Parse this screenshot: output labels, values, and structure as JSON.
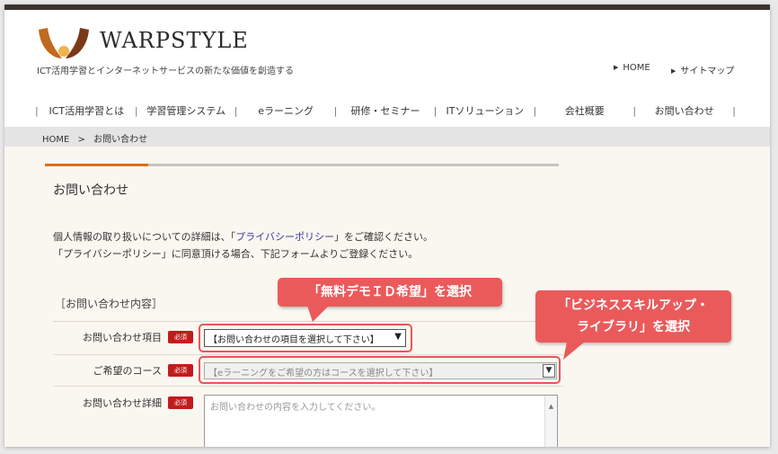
{
  "header": {
    "logo_text": "WARPSTYLE",
    "tagline": "ICT活用学習とインターネットサービスの新たな価値を創造する",
    "util_links": [
      "HOME",
      "サイトマップ"
    ]
  },
  "nav": {
    "items": [
      "ICT活用学習とは",
      "学習管理システム",
      "eラーニング",
      "研修・セミナー",
      "ITソリューション",
      "会社概要",
      "お問い合わせ"
    ]
  },
  "breadcrumb": {
    "home": "HOME",
    "sep": ">",
    "current": "お問い合わせ"
  },
  "page": {
    "title": "お問い合わせ",
    "desc1_pre": "個人情報の取り扱いについての詳細は、「",
    "desc1_link": "プライバシーポリシー",
    "desc1_post": "」をご確認ください。",
    "desc2": "「プライバシーポリシー」に同意頂ける場合、下記フォームよりご登録ください。"
  },
  "form": {
    "section_title": "［お問い合わせ内容］",
    "required_label": "必須",
    "inquiry_item_label": "お問い合わせ項目",
    "inquiry_item_value": "【お問い合わせの項目を選択して下さい】",
    "course_label": "ご希望のコース",
    "course_value": "【eラーニングをご希望の方はコースを選択して下さい】",
    "detail_label": "お問い合わせ詳細",
    "detail_placeholder": "お問い合わせの内容を入力してください。"
  },
  "callouts": {
    "first": "「無料デモＩＤ希望」を選択",
    "second_line1": "「ビジネススキルアップ・",
    "second_line2": "ライブラリ」を選択"
  },
  "colors": {
    "accent": "#e06d1c",
    "required": "#c11c1c",
    "callout": "#ea5a5b",
    "topbar": "#3a332e"
  }
}
